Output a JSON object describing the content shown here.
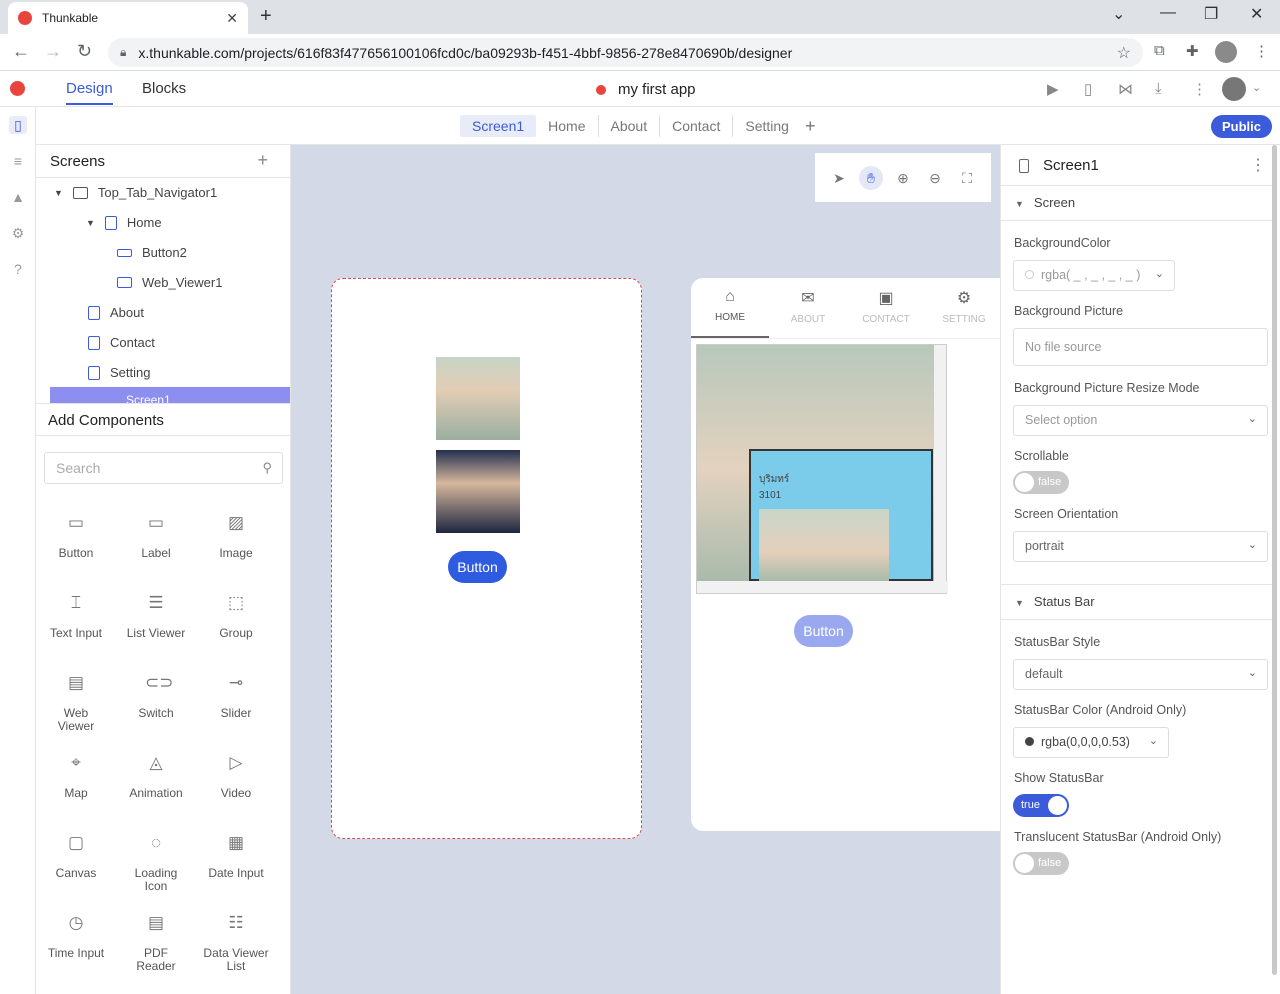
{
  "browser": {
    "tab_title": "Thunkable",
    "url": "x.thunkable.com/projects/616f83f477656100106fcd0c/ba09293b-f451-4bbf-9856-278e8470690b/designer"
  },
  "header": {
    "design_label": "Design",
    "blocks_label": "Blocks",
    "project_name": "my first app"
  },
  "screen_tabs": [
    "Screen1",
    "Home",
    "About",
    "Contact",
    "Setting"
  ],
  "public_label": "Public",
  "screens_panel": {
    "title": "Screens",
    "items": [
      "Top_Tab_Navigator1",
      "Home",
      "Button2",
      "Web_Viewer1",
      "About",
      "Contact",
      "Setting",
      "Screen1"
    ]
  },
  "add_components": {
    "title": "Add Components",
    "search_placeholder": "Search",
    "items": [
      "Button",
      "Label",
      "Image",
      "Text Input",
      "List Viewer",
      "Group",
      "Web Viewer",
      "Switch",
      "Slider",
      "Map",
      "Animation",
      "Video",
      "Canvas",
      "Loading Icon",
      "Date Input",
      "Time Input",
      "PDF Reader",
      "Data Viewer List"
    ]
  },
  "canvas": {
    "edit_button": "Button",
    "preview_tabs": [
      "HOME",
      "ABOUT",
      "CONTACT",
      "SETTING"
    ],
    "preview_text_1": "บุริมทร์",
    "preview_text_2": "3101",
    "preview_button": "Button"
  },
  "properties": {
    "title": "Screen1",
    "section_screen": "Screen",
    "background_color_label": "BackgroundColor",
    "background_color_value": "rgba( _ , _ , _ , _ )",
    "background_picture_label": "Background Picture",
    "background_picture_value": "No file source",
    "resize_mode_label": "Background Picture Resize Mode",
    "resize_mode_value": "Select option",
    "scrollable_label": "Scrollable",
    "scrollable_value": "false",
    "orientation_label": "Screen Orientation",
    "orientation_value": "portrait",
    "section_status": "Status Bar",
    "statusbar_style_label": "StatusBar Style",
    "statusbar_style_value": "default",
    "statusbar_color_label": "StatusBar Color (Android Only)",
    "statusbar_color_value": "rgba(0,0,0,0.53)",
    "show_statusbar_label": "Show StatusBar",
    "show_statusbar_value": "true",
    "translucent_label": "Translucent StatusBar (Android Only)",
    "translucent_value": "false"
  },
  "colors": {
    "accent": "#3b5bdb",
    "canvas_bg": "#d4d9e8",
    "edit_button": "#2f5be0"
  }
}
